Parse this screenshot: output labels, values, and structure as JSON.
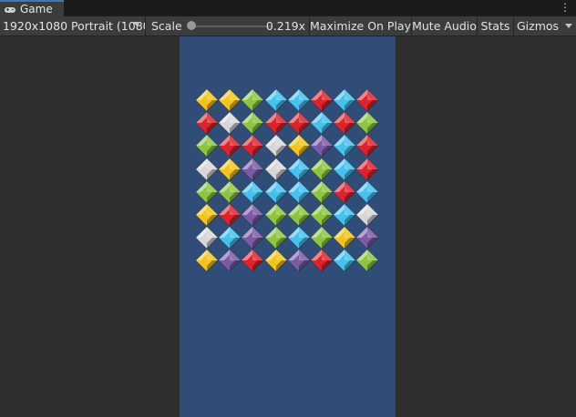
{
  "tab": {
    "label": "Game",
    "icon": "gamepad-icon",
    "menu_icon": "kebab-menu-icon"
  },
  "toolbar": {
    "resolution": "1920x1080 Portrait (1080",
    "scale_label": "Scale",
    "scale_value": "0.219x",
    "scale_fraction": 0.02,
    "maximize": "Maximize On Play",
    "mute": "Mute Audio",
    "stats": "Stats",
    "gizmos": "Gizmos"
  },
  "colors": {
    "canvas_bg": "#2f4d77",
    "yellow": "#f5c518",
    "red": "#e0232b",
    "green": "#8ec63f",
    "blue": "#45c3f0",
    "white": "#d8d8d8",
    "purple": "#7b5aa6"
  },
  "board": {
    "rows": 8,
    "cols": 8,
    "gems": [
      [
        "yellow",
        "yellow",
        "green",
        "blue",
        "blue",
        "red",
        "blue",
        "red"
      ],
      [
        "red",
        "white",
        "green",
        "red",
        "red",
        "blue",
        "red",
        "green"
      ],
      [
        "green",
        "red",
        "red",
        "white",
        "yellow",
        "purple",
        "blue",
        "red"
      ],
      [
        "white",
        "yellow",
        "purple",
        "white",
        "blue",
        "green",
        "blue",
        "red"
      ],
      [
        "green",
        "green",
        "blue",
        "blue",
        "blue",
        "green",
        "red",
        "blue"
      ],
      [
        "yellow",
        "red",
        "purple",
        "green",
        "green",
        "green",
        "blue",
        "white"
      ],
      [
        "white",
        "blue",
        "purple",
        "green",
        "blue",
        "green",
        "yellow",
        "purple"
      ],
      [
        "yellow",
        "purple",
        "red",
        "yellow",
        "purple",
        "red",
        "blue",
        "green"
      ]
    ]
  }
}
